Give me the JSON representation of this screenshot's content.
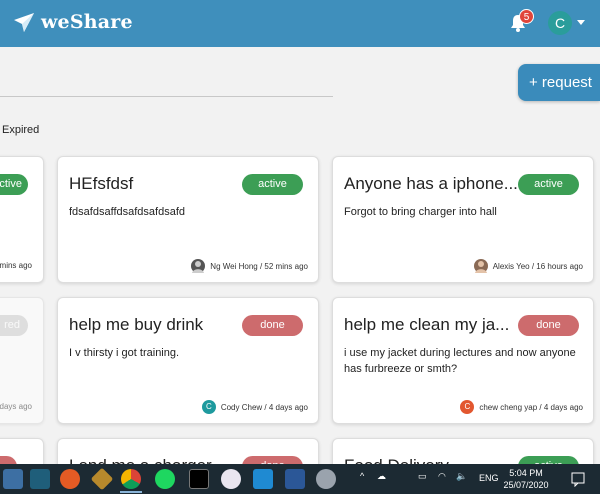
{
  "app": {
    "name": "weShare"
  },
  "header": {
    "notification_count": "5",
    "user_initial": "C"
  },
  "toolbar": {
    "request_label": "+ request"
  },
  "filters": {
    "expired_label": "Expired"
  },
  "cards": {
    "left_top": {
      "badge": "active",
      "time": "mins ago"
    },
    "left_mid": {
      "badge": "red",
      "time": "days ago"
    },
    "c1": {
      "title": "HEfsfdsf",
      "desc": "fdsafdsaffdsafdsafdsafd",
      "status": "active",
      "author": "Ng Wei Hong",
      "time": "52 mins ago"
    },
    "c2": {
      "title": "Anyone has a iphone...",
      "desc": "Forgot to bring charger into hall",
      "status": "active",
      "author": "Alexis Yeo",
      "time": "16 hours ago"
    },
    "c3": {
      "title": "help me buy drink",
      "desc": "I v thirsty i got training.",
      "status": "done",
      "author": "Cody Chew",
      "author_initial": "C",
      "time": "4 days ago"
    },
    "c4": {
      "title": "help me clean my ja...",
      "desc": "i use my jacket during lectures and now anyone has furbreeze or smth?",
      "status": "done",
      "author": "chew cheng yap",
      "author_initial": "C",
      "time": "4 days ago"
    },
    "c5": {
      "title": "Lend me a charger",
      "status": "done"
    },
    "c6": {
      "title": "Food Delivery",
      "status": "active"
    }
  },
  "taskbar": {
    "lang": "ENG",
    "time": "5:04 PM",
    "date": "25/07/2020"
  },
  "colors": {
    "header": "#3f8fbc",
    "active": "#3c9e55",
    "done": "#cd6b6d",
    "taskbar": "#1c2a33"
  }
}
